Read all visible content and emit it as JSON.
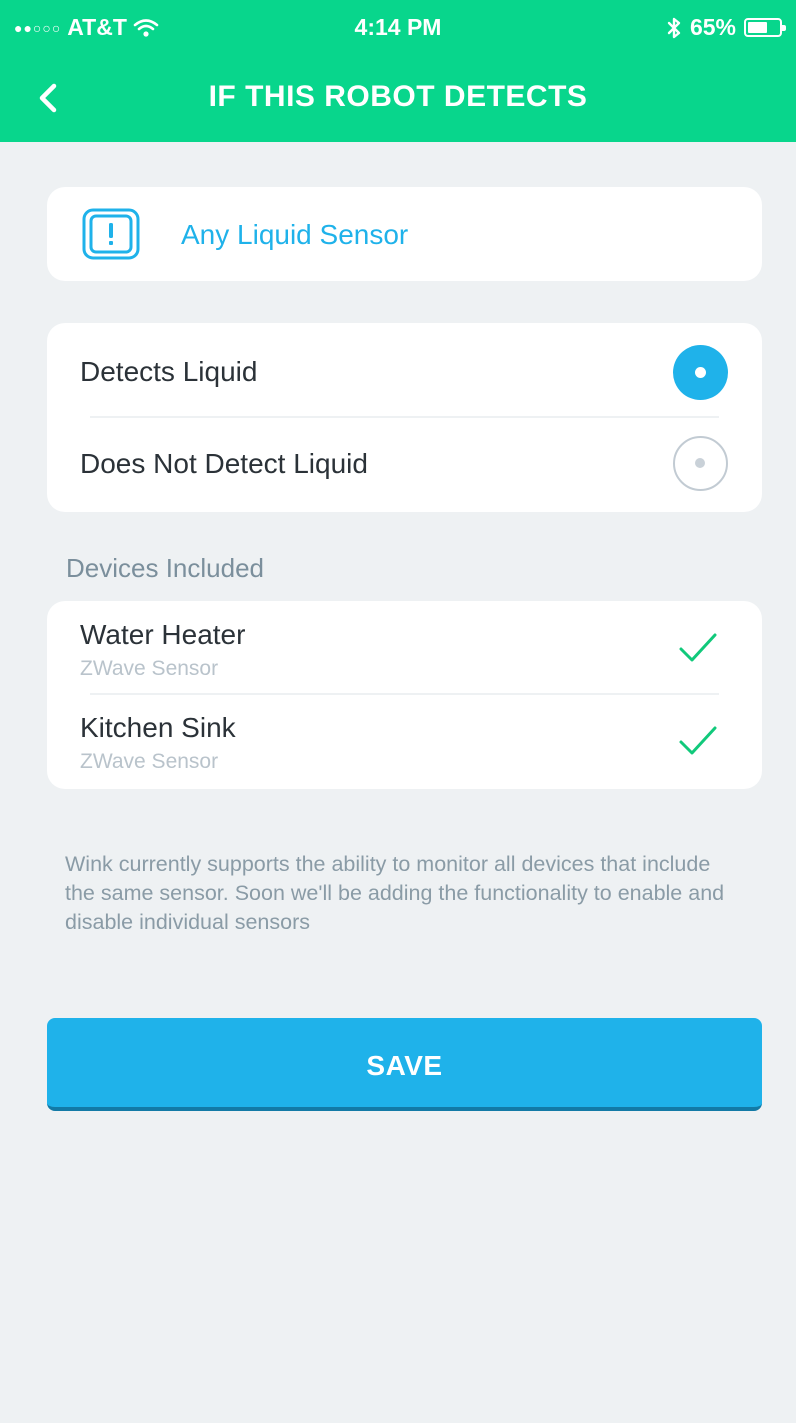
{
  "status_bar": {
    "carrier": "AT&T",
    "time": "4:14 PM",
    "battery": "65%",
    "battery_level": 0.65
  },
  "nav": {
    "title": "IF THIS ROBOT DETECTS"
  },
  "sensor": {
    "label": "Any Liquid Sensor",
    "icon": "liquid-sensor-icon"
  },
  "options": [
    {
      "label": "Detects Liquid",
      "selected": true
    },
    {
      "label": "Does Not Detect Liquid",
      "selected": false
    }
  ],
  "devices_section": {
    "label": "Devices Included",
    "devices": [
      {
        "name": "Water Heater",
        "type": "ZWave Sensor",
        "included": true
      },
      {
        "name": "Kitchen Sink",
        "type": "ZWave Sensor",
        "included": true
      }
    ]
  },
  "note": "Wink currently supports the ability to monitor all devices that include the same sensor. Soon we'll be adding the functionality to enable and disable individual sensors",
  "save_label": "SAVE",
  "colors": {
    "header": "#08d68c",
    "accent": "#1fb2ea",
    "check": "#11c97b",
    "background": "#eef1f3"
  }
}
